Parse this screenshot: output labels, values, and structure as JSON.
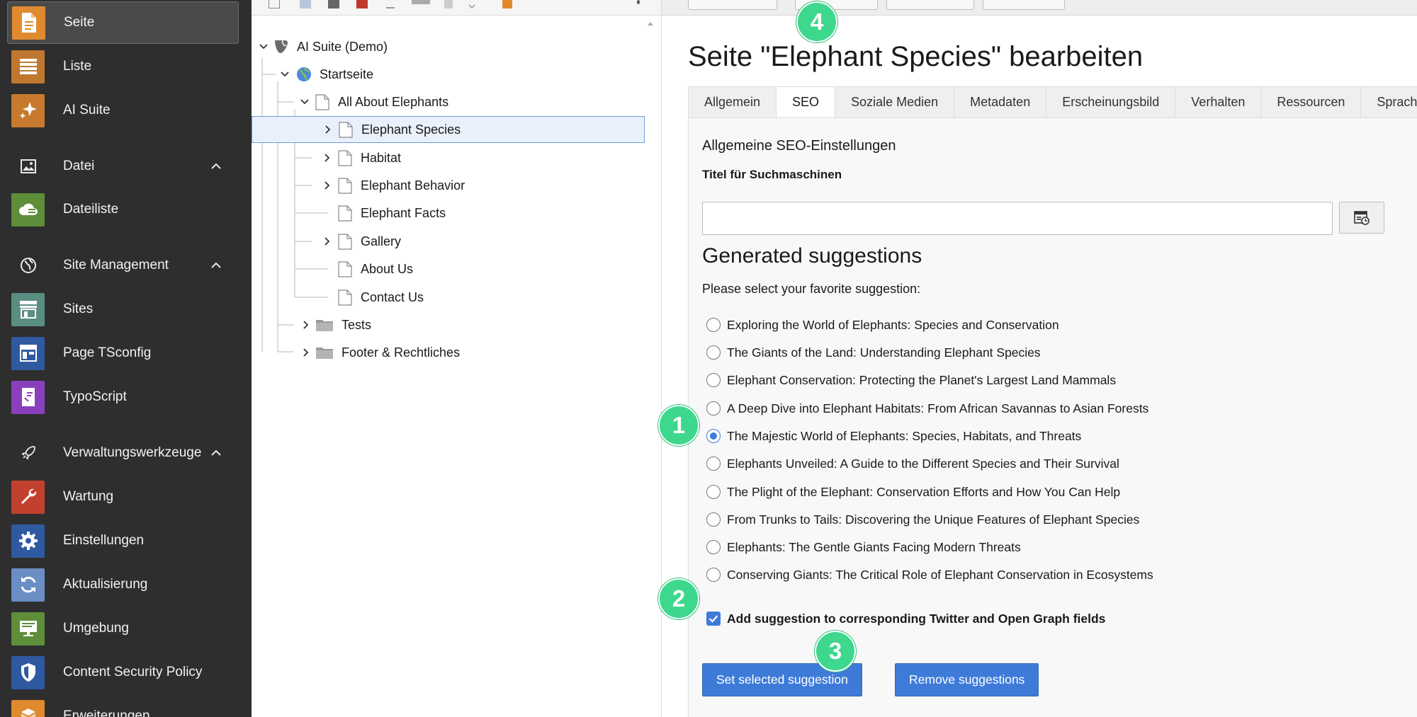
{
  "modules": {
    "items": [
      {
        "label": "Seite",
        "icon": "page-icon",
        "color": "#e08a2f"
      },
      {
        "label": "Liste",
        "icon": "list-icon",
        "color": "#c0772f"
      },
      {
        "label": "AI Suite",
        "icon": "sparkle-icon",
        "color": "#c77a2e"
      },
      {
        "label": "Datei",
        "icon": "image-icon"
      },
      {
        "label": "Dateiliste",
        "icon": "cloud-file-icon",
        "color": "#5e8e3a"
      },
      {
        "label": "Site Management",
        "icon": "globe-icon"
      },
      {
        "label": "Sites",
        "icon": "storefront-icon",
        "color": "#5a8e82"
      },
      {
        "label": "Page TSconfig",
        "icon": "layout-icon",
        "color": "#2f5aa1"
      },
      {
        "label": "TypoScript",
        "icon": "code-file-icon",
        "color": "#8a3fbd"
      },
      {
        "label": "Verwaltungswerkzeuge",
        "icon": "rocket-icon"
      },
      {
        "label": "Wartung",
        "icon": "wrench-icon",
        "color": "#c2412e"
      },
      {
        "label": "Einstellungen",
        "icon": "gear-icon",
        "color": "#2f5aa1"
      },
      {
        "label": "Aktualisierung",
        "icon": "refresh-icon",
        "color": "#6b8fc4"
      },
      {
        "label": "Umgebung",
        "icon": "monitor-icon",
        "color": "#5e8e3a"
      },
      {
        "label": "Content Security Policy",
        "icon": "shield-icon",
        "color": "#2f5aa1"
      },
      {
        "label": "Erweiterungen",
        "icon": "box-icon",
        "color": "#e08a2f"
      }
    ]
  },
  "tree": {
    "root": "AI Suite (Demo)",
    "nodes": [
      {
        "label": "Startseite"
      },
      {
        "label": "All About Elephants"
      },
      {
        "label": "Elephant Species"
      },
      {
        "label": "Habitat"
      },
      {
        "label": "Elephant Behavior"
      },
      {
        "label": "Elephant Facts"
      },
      {
        "label": "Gallery"
      },
      {
        "label": "About Us"
      },
      {
        "label": "Contact Us"
      },
      {
        "label": "Tests"
      },
      {
        "label": "Footer & Rechtliches"
      }
    ]
  },
  "content": {
    "title": "Seite \"Elephant Species\" bearbeiten",
    "tabs": [
      "Allgemein",
      "SEO",
      "Soziale Medien",
      "Metadaten",
      "Erscheinungsbild",
      "Verhalten",
      "Ressourcen",
      "Sprache"
    ],
    "active_tab": "SEO",
    "section_title": "Allgemeine SEO-Einstellungen",
    "seo_title_label": "Titel für Suchmaschinen",
    "seo_title_value": "",
    "suggestions_heading": "Generated suggestions",
    "suggestions_hint": "Please select your favorite suggestion:",
    "suggestions": [
      "Exploring the World of Elephants: Species and Conservation",
      "The Giants of the Land: Understanding Elephant Species",
      "Elephant Conservation: Protecting the Planet's Largest Land Mammals",
      "A Deep Dive into Elephant Habitats: From African Savannas to Asian Forests",
      "The Majestic World of Elephants: Species, Habitats, and Threats",
      "Elephants Unveiled: A Guide to the Different Species and Their Survival",
      "The Plight of the Elephant: Conservation Efforts and How You Can Help",
      "From Trunks to Tails: Discovering the Unique Features of Elephant Species",
      "Elephants: The Gentle Giants Facing Modern Threats",
      "Conserving Giants: The Critical Role of Elephant Conservation in Ecosystems"
    ],
    "selected_suggestion": 4,
    "social_checkbox_label": "Add suggestion to corresponding Twitter and Open Graph fields",
    "social_checkbox_checked": true,
    "set_button": "Set selected suggestion",
    "remove_button": "Remove suggestions"
  },
  "callouts": [
    "1",
    "2",
    "3",
    "4"
  ],
  "colors": {
    "accent": "#3e7bd9",
    "callout": "#3dd88d",
    "sidebar": "#2e2e2e"
  }
}
